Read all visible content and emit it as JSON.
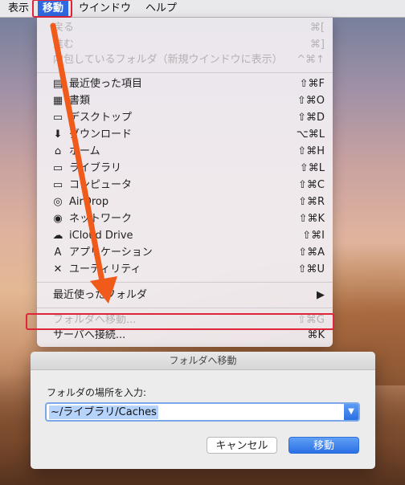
{
  "menubar": {
    "items": [
      {
        "label": "表示"
      },
      {
        "label": "移動"
      },
      {
        "label": "ウインドウ"
      },
      {
        "label": "ヘルプ"
      }
    ]
  },
  "menu": {
    "items": [
      {
        "label": "戻る",
        "shortcut": "⌘[",
        "enabled": false
      },
      {
        "label": "進む",
        "shortcut": "⌘]",
        "enabled": false
      },
      {
        "label": "内包しているフォルダ（新規ウインドウに表示）",
        "shortcut": "^⌘↑",
        "enabled": false
      },
      {
        "label": "最近使った項目",
        "shortcut": "⇧⌘F",
        "icon": "recents-icon"
      },
      {
        "label": "書類",
        "shortcut": "⇧⌘O",
        "icon": "documents-icon"
      },
      {
        "label": "デスクトップ",
        "shortcut": "⇧⌘D",
        "icon": "desktop-icon"
      },
      {
        "label": "ダウンロード",
        "shortcut": "⌥⌘L",
        "icon": "downloads-icon"
      },
      {
        "label": "ホーム",
        "shortcut": "⇧⌘H",
        "icon": "home-icon"
      },
      {
        "label": "ライブラリ",
        "shortcut": "⇧⌘L",
        "icon": "folder-icon"
      },
      {
        "label": "コンピュータ",
        "shortcut": "⇧⌘C",
        "icon": "computer-icon"
      },
      {
        "label": "AirDrop",
        "shortcut": "⇧⌘R",
        "icon": "airdrop-icon"
      },
      {
        "label": "ネットワーク",
        "shortcut": "⇧⌘K",
        "icon": "network-icon"
      },
      {
        "label": "iCloud Drive",
        "shortcut": "⇧⌘I",
        "icon": "icloud-icon"
      },
      {
        "label": "アプリケーション",
        "shortcut": "⇧⌘A",
        "icon": "applications-icon"
      },
      {
        "label": "ユーティリティ",
        "shortcut": "⇧⌘U",
        "icon": "utilities-icon"
      },
      {
        "label": "最近使ったフォルダ",
        "shortcut": "▶"
      },
      {
        "label": "フォルダへ移動...",
        "shortcut": "⇧⌘G",
        "enabled": false
      },
      {
        "label": "サーバへ接続...",
        "shortcut": "⌘K"
      }
    ]
  },
  "dialog": {
    "title": "フォルダへ移動",
    "prompt": "フォルダの場所を入力:",
    "path_value": "~/ライブラリ/Caches",
    "cancel_label": "キャンセル",
    "go_label": "移動"
  },
  "colors": {
    "accent": "#2f68e0",
    "highlight": "#e0243a",
    "arrow": "#f05a1a"
  }
}
